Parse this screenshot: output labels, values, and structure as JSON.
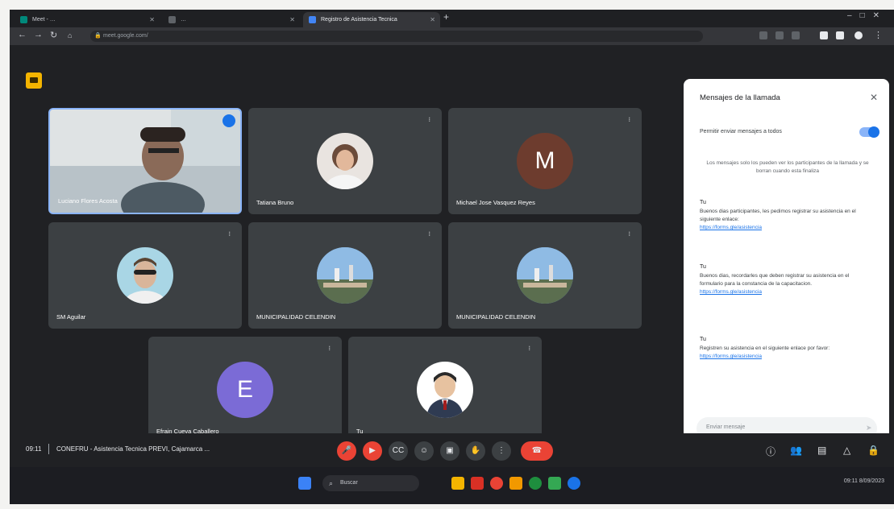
{
  "browser": {
    "tabs": [
      {
        "label": "Meet - …",
        "favicon_color": "#00897b"
      },
      {
        "label": "…",
        "favicon_color": "#5f6368"
      },
      {
        "label": "Registro de Asistencia Tecnica",
        "favicon_color": "#4285f4"
      }
    ],
    "url": "meet.google.com/"
  },
  "meet": {
    "tiles": [
      {
        "name": "Luciano Flores Acosta",
        "type": "video"
      },
      {
        "name": "Tatiana Bruno",
        "type": "photo",
        "photo_style": "woman"
      },
      {
        "name": "Michael Jose Vasquez Reyes",
        "type": "letter",
        "letter": "M",
        "color": "#6d3c2e"
      },
      {
        "name": "SM Aguilar",
        "type": "photo",
        "photo_style": "man-glasses"
      },
      {
        "name": "MUNICIPALIDAD CELENDIN",
        "type": "photo",
        "photo_style": "landscape"
      },
      {
        "name": "MUNICIPALIDAD CELENDIN",
        "type": "photo",
        "photo_style": "landscape"
      },
      {
        "name": "Efrain Cueva Caballero",
        "type": "letter",
        "letter": "E",
        "color": "#7b6bd6"
      },
      {
        "name": "Tu",
        "type": "photo",
        "photo_style": "cartoon"
      }
    ],
    "meeting_time": "09:11",
    "meeting_title": "CONEFRU - Asistencia Tecnica PREVI, Cajamarca ..."
  },
  "chat": {
    "title": "Mensajes de la llamada",
    "toggle_label": "Permitir enviar mensajes a todos",
    "toggle_on": true,
    "notice": "Los mensajes solo los pueden ver los participantes de la llamada y se borran cuando esta finaliza",
    "messages": [
      {
        "sender": "Tu",
        "time": "",
        "body": "Buenos dias participantes, les pedimos registrar su asistencia en el siguiente enlace:",
        "link": "https://forms.gle/asistencia"
      },
      {
        "sender": "Tu",
        "time": "",
        "body": "Buenos dias, recordarles que deben registrar su asistencia en el formulario para la constancia de la capacitacion.",
        "link": "https://forms.gle/asistencia"
      },
      {
        "sender": "Tu",
        "time": "",
        "body": "Registren su asistencia en el siguiente enlace por favor:",
        "link": "https://forms.gle/asistencia"
      }
    ],
    "input_placeholder": "Enviar mensaje"
  },
  "taskbar": {
    "search_placeholder": "Buscar",
    "time": "09:11",
    "date": "8/09/2023"
  },
  "colors": {
    "meet_bg": "#202124",
    "tile_bg": "#3c4043",
    "accent_blue": "#1a73e8",
    "end_call_red": "#ea4335"
  }
}
